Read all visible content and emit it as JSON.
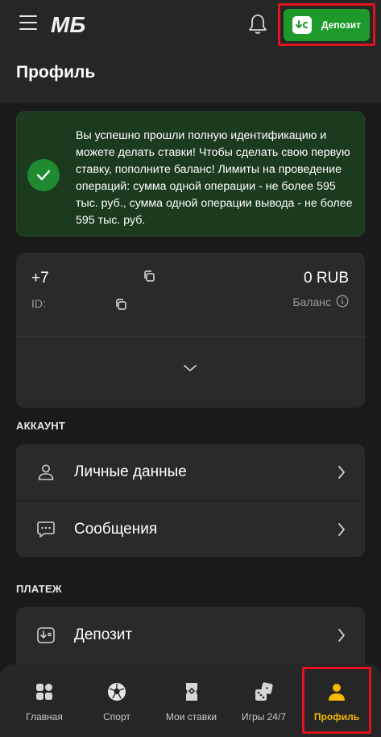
{
  "header": {
    "logo_text": "МБ",
    "deposit_label": "Депозит",
    "page_title": "Профиль"
  },
  "notice": {
    "text": "Вы успешно прошли полную идентификацию и можете делать ставки! Чтобы сделать свою первую ставку, пополните баланс! Лимиты на проведение операций: сумма одной операции - не более 595 тыс. руб., сумма одной операции вывода - не более 595 тыс. руб."
  },
  "account": {
    "phone": "+7",
    "id_label": "ID:",
    "balance_value": "0 RUB",
    "balance_label": "Баланс"
  },
  "sections": {
    "account_title": "АККАУНТ",
    "payment_title": "ПЛАТЕЖ"
  },
  "account_menu": [
    {
      "label": "Личные данные",
      "icon": "person-icon"
    },
    {
      "label": "Сообщения",
      "icon": "chat-icon"
    }
  ],
  "payment_menu": [
    {
      "label": "Депозит",
      "icon": "deposit-icon"
    }
  ],
  "bottom_nav": [
    {
      "label": "Главная",
      "icon": "grid-icon"
    },
    {
      "label": "Спорт",
      "icon": "soccer-ball-icon"
    },
    {
      "label": "Мои ставки",
      "icon": "ticket-icon"
    },
    {
      "label": "Игры 24/7",
      "icon": "dice-icon"
    },
    {
      "label": "Профиль",
      "icon": "person-icon",
      "active": true
    }
  ],
  "colors": {
    "accent_green": "#1e9a2b",
    "active_yellow": "#f5b900",
    "highlight_red": "#e0141e"
  }
}
